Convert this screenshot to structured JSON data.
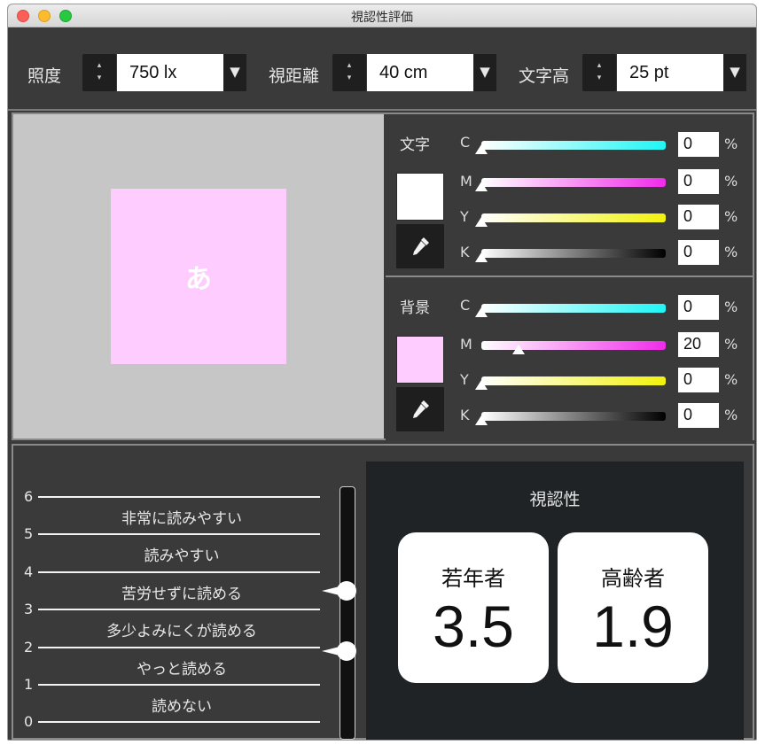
{
  "window": {
    "title": "視認性評価"
  },
  "toolbar": {
    "illuminance": {
      "label": "照度",
      "value": "750 lx"
    },
    "distance": {
      "label": "視距離",
      "value": "40 cm"
    },
    "text_height": {
      "label": "文字高",
      "value": "25 pt"
    },
    "stepper_up": "▴",
    "stepper_down": "▾",
    "dropdown_glyph": "▼"
  },
  "preview": {
    "sample_char": "あ",
    "background_color": "#ffccff",
    "text_color": "#ffffff"
  },
  "text_color": {
    "label": "文字",
    "swatch_color": "#ffffff",
    "channels": [
      {
        "name": "C",
        "value": "0",
        "level": 0
      },
      {
        "name": "M",
        "value": "0",
        "level": 0
      },
      {
        "name": "Y",
        "value": "0",
        "level": 0
      },
      {
        "name": "K",
        "value": "0",
        "level": 0
      }
    ]
  },
  "background_color": {
    "label": "背景",
    "swatch_color": "#ffccff",
    "channels": [
      {
        "name": "C",
        "value": "0",
        "level": 0
      },
      {
        "name": "M",
        "value": "20",
        "level": 0.2
      },
      {
        "name": "Y",
        "value": "0",
        "level": 0
      },
      {
        "name": "K",
        "value": "0",
        "level": 0
      }
    ]
  },
  "percent_sign": "%",
  "scale": {
    "ticks": [
      "6",
      "5",
      "4",
      "3",
      "2",
      "1",
      "0"
    ],
    "levels": [
      "非常に読みやすい",
      "読みやすい",
      "苦労せずに読める",
      "多少よみにくが読める",
      "やっと読める",
      "読めない"
    ],
    "young_marker": 3.5,
    "elderly_marker": 1.9
  },
  "visibility": {
    "title": "視認性",
    "young": {
      "label": "若年者",
      "value": "3.5"
    },
    "elderly": {
      "label": "高齢者",
      "value": "1.9"
    }
  },
  "icons": {
    "dropper": "eyedropper-icon"
  }
}
